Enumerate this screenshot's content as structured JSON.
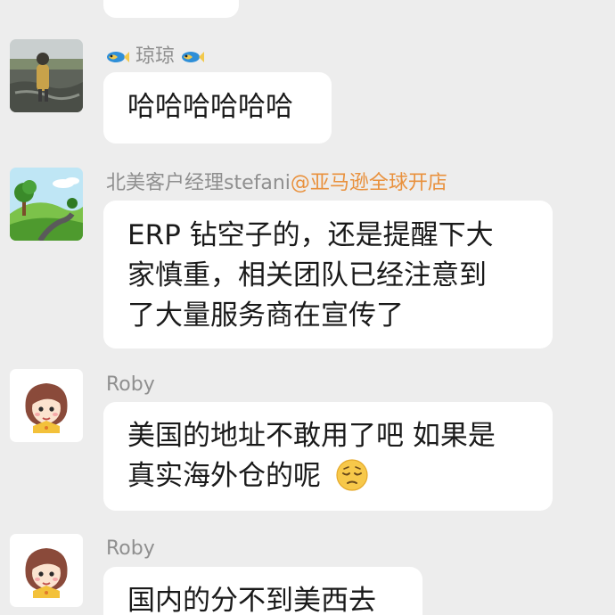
{
  "messages": [
    {
      "sender": "",
      "text": ""
    },
    {
      "sender": "琼琼",
      "text": "哈哈哈哈哈哈"
    },
    {
      "sender": "北美客户经理stefani",
      "sender_tag": "@亚马逊全球开店",
      "lines": [
        "ERP 钻空子的，还是提醒下大",
        "家慎重，相关团队已经注意到",
        "了大量服务商在宣传了"
      ]
    },
    {
      "sender": "Roby",
      "lines": [
        "美国的地址不敢用了吧 如果是",
        "真实海外仓的呢"
      ],
      "emoji": "pensive-face"
    },
    {
      "sender": "Roby",
      "text": "国内的分不到美西去"
    }
  ],
  "colors": {
    "background": "#ededed",
    "bubble": "#ffffff",
    "sender_name": "#8f8f8f",
    "sender_tag": "#e9913d"
  }
}
